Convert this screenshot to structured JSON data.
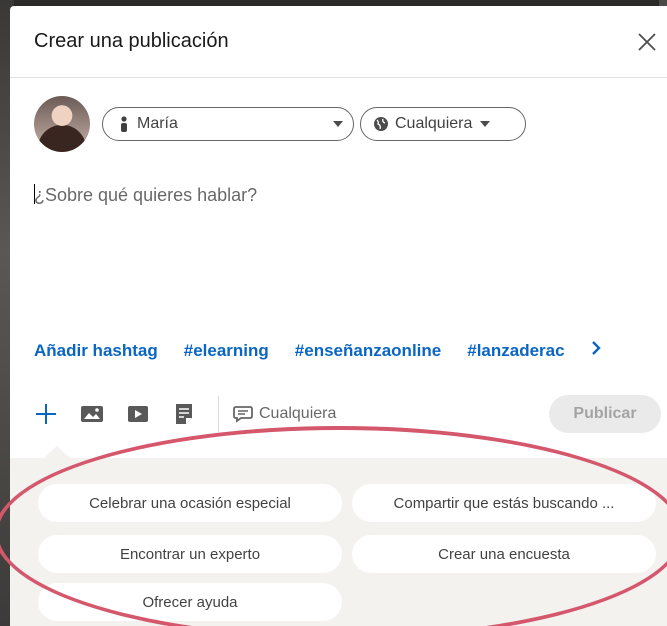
{
  "modal": {
    "title": "Crear una publicación"
  },
  "author": {
    "name": "María",
    "visibility": "Cualquiera"
  },
  "editor": {
    "placeholder": "¿Sobre qué quieres hablar?"
  },
  "hashtags": {
    "add_label": "Añadir hashtag",
    "tags": [
      "#elearning",
      "#enseñanzaonline",
      "#lanzaderac"
    ]
  },
  "toolbar": {
    "comment_visibility": "Cualquiera",
    "publish_label": "Publicar"
  },
  "suggestions": [
    "Celebrar una ocasión especial",
    "Compartir que estás buscando ...",
    "Encontrar un experto",
    "Crear una encuesta",
    "Ofrecer ayuda"
  ],
  "colors": {
    "link_blue": "#0a66c2",
    "highlight_oval": "#d4576c",
    "suggest_bg": "#f3f2ef"
  }
}
